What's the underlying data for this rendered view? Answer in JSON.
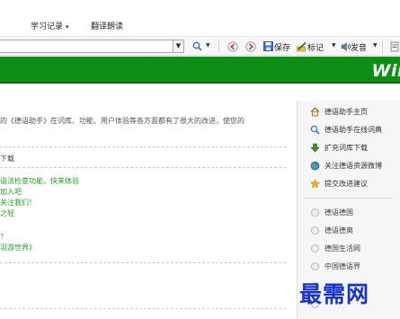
{
  "menu": {
    "partial_first": "ł",
    "study_records": "学习记录",
    "study_arrow": "▾",
    "translate_read": "翻译朗读"
  },
  "toolbar": {
    "search_value": "",
    "save_label": "保存",
    "mark_label": "标记",
    "speak_label": "发音"
  },
  "banner": {
    "brand_partial": "Wil",
    "color": "#0d8f15"
  },
  "main": {
    "intro_text": "的《德语助手》在词库、功能、用户体验等各方面都有了很大的改进，使您的",
    "section_label": "下载",
    "news": [
      "语法检查功能，快来体验",
      "加入吧",
      "关注我们！",
      "之轻",
      "？",
      "羽游世界》"
    ]
  },
  "sidebar": {
    "links": [
      {
        "label": "德语助手主页",
        "icon": "home-icon"
      },
      {
        "label": "德语助手在线词典",
        "icon": "magnifier-icon"
      },
      {
        "label": "扩充词库下载",
        "icon": "download-arrow-icon"
      },
      {
        "label": "关注德语资源微博",
        "icon": "globe-icon"
      },
      {
        "label": "提交改进建议",
        "icon": "star-icon"
      }
    ],
    "sites": [
      "德语德国",
      "德语德奥",
      "德国生活网",
      "中国德语界"
    ]
  },
  "watermark": "最需网"
}
